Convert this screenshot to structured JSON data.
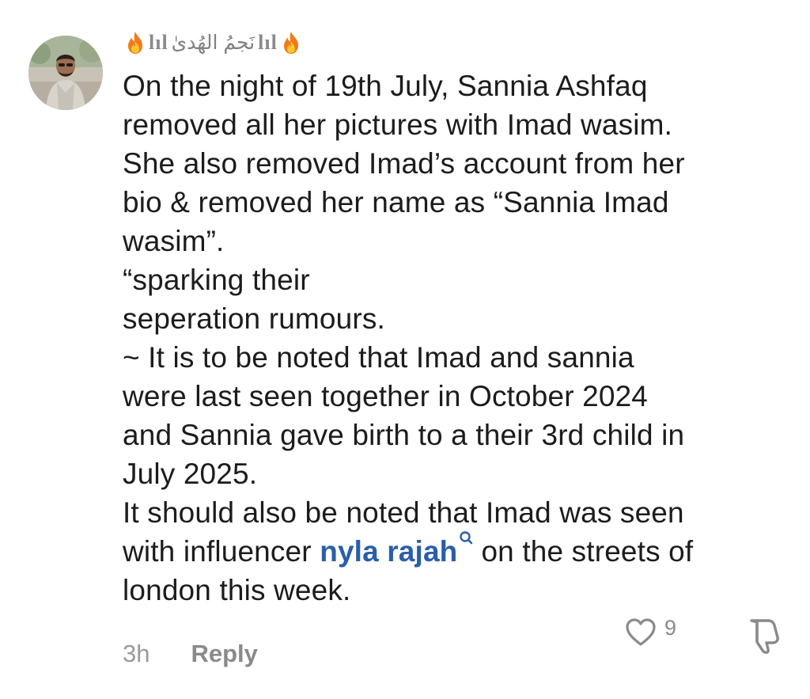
{
  "comment": {
    "username": "نَجمُ الهُدیٰ",
    "username_decoration_left": "lıl",
    "username_decoration_right": "lıl",
    "lines": [
      "On the night of 19th July, Sannia Ashfaq",
      "removed all her pictures with Imad wasim.",
      "She also removed Imad’s account from her",
      "bio & removed her name as “Sannia Imad",
      "wasim”.",
      "“sparking their",
      "seperation rumours.",
      "~ It is to be noted that Imad and sannia",
      "were last seen together in October 2024",
      "and Sannia gave birth to a their 3rd child in",
      "July 2025.",
      "It should also be noted that Imad was seen"
    ],
    "mention_line_prefix": "with influencer ",
    "mention": "nyla rajah",
    "mention_line_suffix": "on the streets of",
    "last_line": "london this week.",
    "timestamp": "3h",
    "reply_label": "Reply",
    "like_count": "9"
  },
  "icons": {
    "flame": "fire-emoji-icon",
    "mention_search": "search-icon",
    "like": "heart-outline-icon",
    "dislike": "thumbs-down-outline-icon"
  },
  "colors": {
    "mention": "#2b5ea7",
    "muted": "#8a8a8a",
    "text": "#1c1c1c"
  }
}
